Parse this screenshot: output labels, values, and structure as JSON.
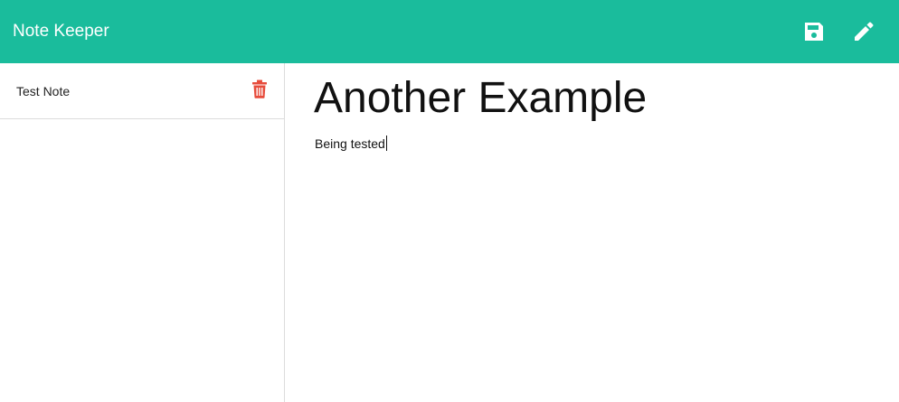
{
  "app": {
    "brand": "Note Keeper",
    "accent_color": "#1abc9c",
    "delete_color": "#e74c3c"
  },
  "toolbar": {
    "save_icon": "floppy-disk-icon",
    "edit_icon": "pencil-icon"
  },
  "sidebar": {
    "notes": [
      {
        "title": "Test Note",
        "action_icon": "trash-icon"
      }
    ]
  },
  "editor": {
    "title": "Another Example",
    "body": "Being tested"
  }
}
